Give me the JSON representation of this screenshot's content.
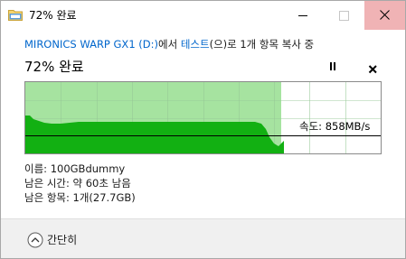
{
  "window": {
    "title": "72% 완료"
  },
  "copy": {
    "source_name": "MIRONICS WARP GX1 (D:)",
    "connector_from": "에서 ",
    "dest_name": "테스트",
    "connector_to": "(으)로 1개 항목 복사 중"
  },
  "progress": {
    "percent_label": "72% 완료",
    "value": 0.72
  },
  "controls": {
    "pause": "pause-icon",
    "cancel": "close-icon"
  },
  "speed": {
    "label": "속도: 858MB/s"
  },
  "details": {
    "name": "이름: 100GBdummy",
    "time_remaining": "남은 시간: 약 60초 남음",
    "items_remaining": "남은 항목: 1개(27.7GB)"
  },
  "footer": {
    "toggle_label": "간단히",
    "toggle_icon": "chevron-up-circle-icon"
  },
  "colors": {
    "progress_fill": "#a6e3a0",
    "throughput_fill": "#12b012",
    "title_link": "#0066cc",
    "close_hover": "#f0b3b5"
  }
}
